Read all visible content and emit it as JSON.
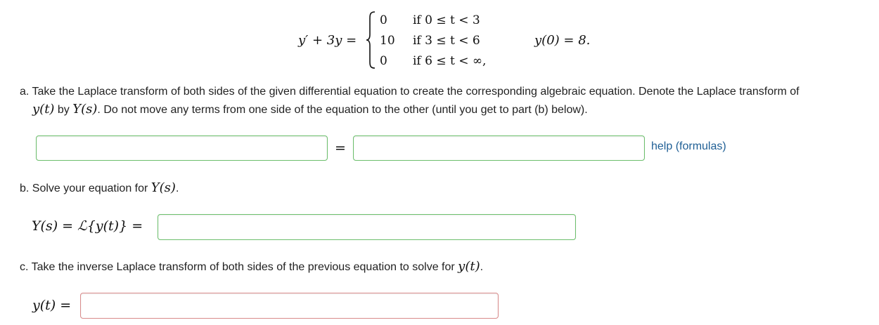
{
  "equation": {
    "lhs": "y′ + 3y =",
    "cases": [
      {
        "value": "0",
        "condition": "if 0 ≤ t < 3"
      },
      {
        "value": "10",
        "condition": "if 3 ≤ t < 6"
      },
      {
        "value": "0",
        "condition": "if 6 ≤ t < ∞,"
      }
    ],
    "initial_condition": "y(0) = 8."
  },
  "part_a": {
    "text1": "a. Take the Laplace transform of both sides of the given differential equation to create the corresponding algebraic equation. Denote the Laplace transform of",
    "yt": "y(t)",
    "by": " by ",
    "Ys": "Y(s)",
    "text2": ". Do not move any terms from one side of the equation to the other (until you get to part (b) below).",
    "equals": "=",
    "left_value": "",
    "right_value": "",
    "help_link": "help (formulas)"
  },
  "part_b": {
    "text": "b. Solve your equation for ",
    "Ys": "Y(s)",
    "period": ".",
    "label": "Y(s) = ℒ{y(t)} =",
    "value": ""
  },
  "part_c": {
    "text": "c. Take the inverse Laplace transform of both sides of the previous equation to solve for ",
    "yt": "y(t)",
    "period": ".",
    "label": "y(t) =",
    "value": ""
  },
  "colors": {
    "correct_border": "#6cbf6c",
    "incorrect_border": "#d98b8b",
    "link": "#1f5f95"
  }
}
